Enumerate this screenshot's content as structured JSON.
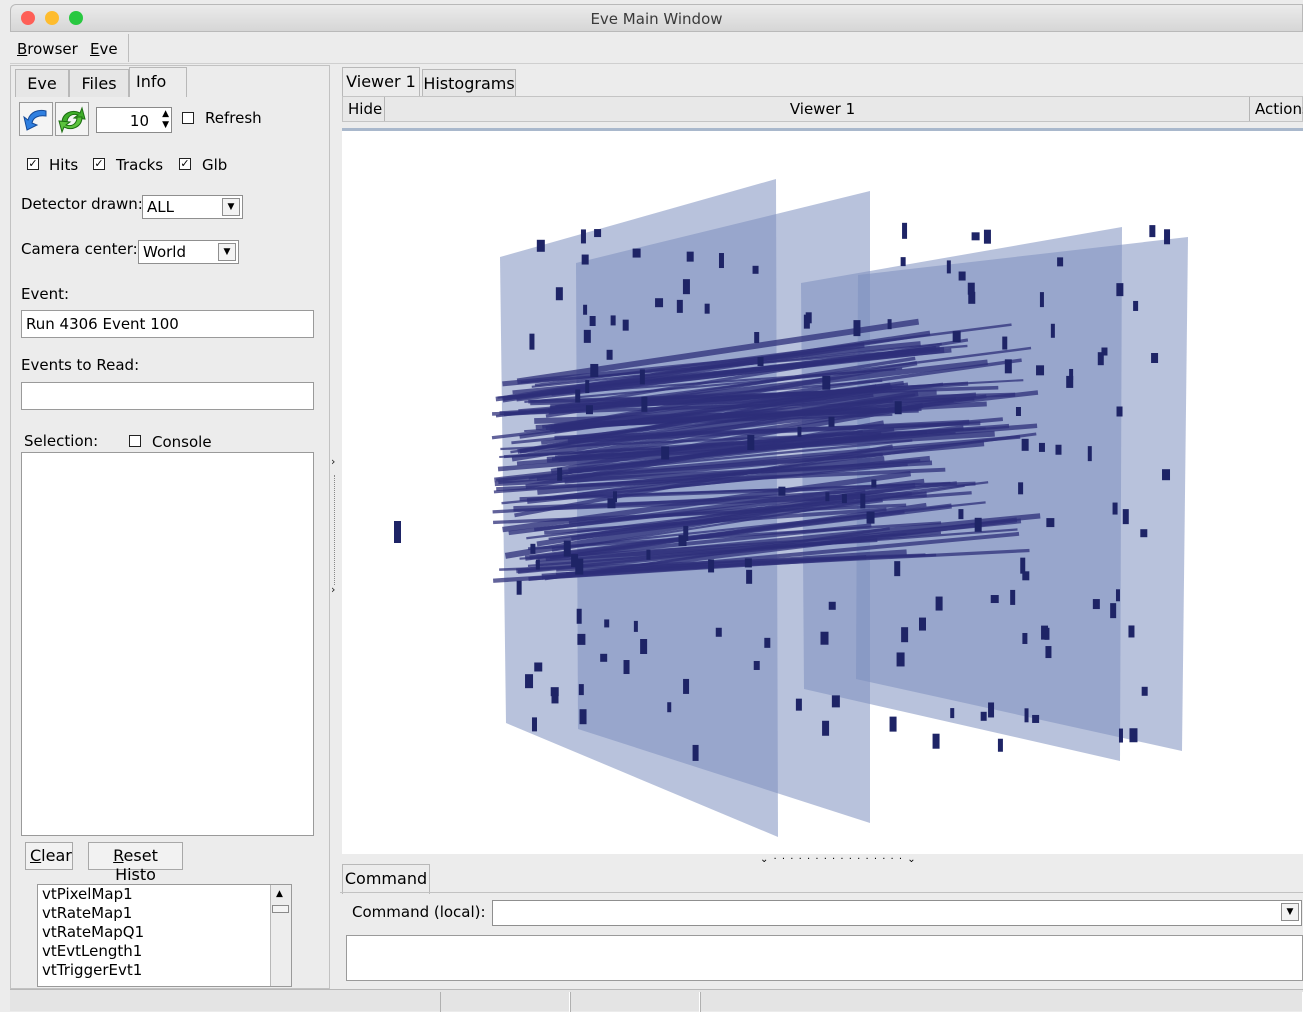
{
  "window": {
    "title": "Eve Main Window",
    "traffic_colors": {
      "close": "#fe5f57",
      "minimize": "#febc2e",
      "zoom": "#28c840"
    }
  },
  "menubar": {
    "items": [
      {
        "first": "B",
        "rest": "rowser"
      },
      {
        "first": "E",
        "rest": "ve"
      }
    ]
  },
  "left_tabs": [
    "Eve",
    "Files",
    "Info"
  ],
  "left_panel": {
    "icons": [
      "back-arrow-icon",
      "reload-cycle-icon"
    ],
    "event_count": "10",
    "refresh_label": "Refresh",
    "checkboxes": [
      {
        "label": "Hits",
        "checked": true
      },
      {
        "label": "Tracks",
        "checked": true
      },
      {
        "label": "Glb",
        "checked": true
      }
    ],
    "detector_label": "Detector drawn:",
    "detector_value": "ALL",
    "camera_label": "Camera center:",
    "camera_value": "World",
    "event_label": "Event:",
    "event_value": "Run 4306 Event 100",
    "events_to_read_label": "Events to Read:",
    "events_to_read_value": "",
    "selection_label": "Selection:",
    "console_label": "Console",
    "clear": {
      "first": "C",
      "rest": "lear"
    },
    "reset": {
      "first": "R",
      "rest": "eset Histo"
    },
    "histograms": [
      "vtPixelMap1",
      "vtRateMap1",
      "vtRateMapQ1",
      "vtEvtLength1",
      "vtTriggerEvt1"
    ]
  },
  "right_tabs": [
    "Viewer 1",
    "Histograms"
  ],
  "viewer_header": {
    "hide": "Hide",
    "title": "Viewer 1",
    "actions": "Actions"
  },
  "command": {
    "tab": "Command",
    "label": "Command (local):",
    "value": ""
  },
  "colors": {
    "plane_fill": "#7d8fbf",
    "track": "#2e2f7a",
    "hit": "#1e2466"
  }
}
